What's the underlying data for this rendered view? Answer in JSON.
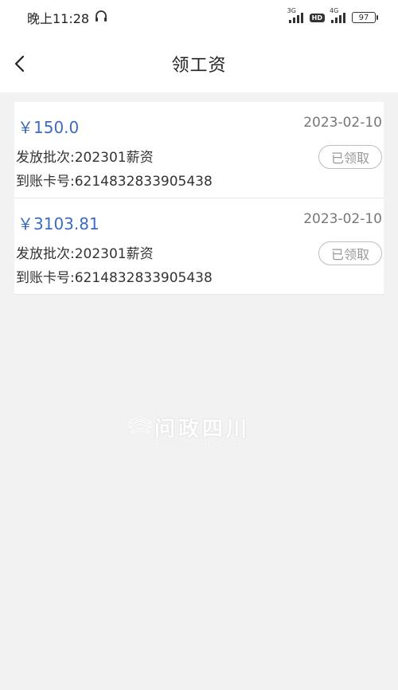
{
  "status_bar": {
    "time": "晚上11:28",
    "net1": "3G",
    "hd": "HD",
    "net2": "4G",
    "battery": "97"
  },
  "header": {
    "title": "领工资",
    "back_icon": "chevron-left-icon"
  },
  "records": [
    {
      "amount": "￥150.0",
      "date": "2023-02-10",
      "batch": "发放批次:202301薪资",
      "card": "到账卡号:6214832833905438",
      "status": "已领取"
    },
    {
      "amount": "￥3103.81",
      "date": "2023-02-10",
      "batch": "发放批次:202301薪资",
      "card": "到账卡号:6214832833905438",
      "status": "已领取"
    }
  ],
  "watermark": {
    "brand": "问政四川",
    "slogan": "有问必回答 · 有求必解决"
  },
  "colors": {
    "amount": "#3d6bc4",
    "background": "#f2f2f2",
    "card": "#ffffff",
    "status_border": "#bdbdbd"
  }
}
